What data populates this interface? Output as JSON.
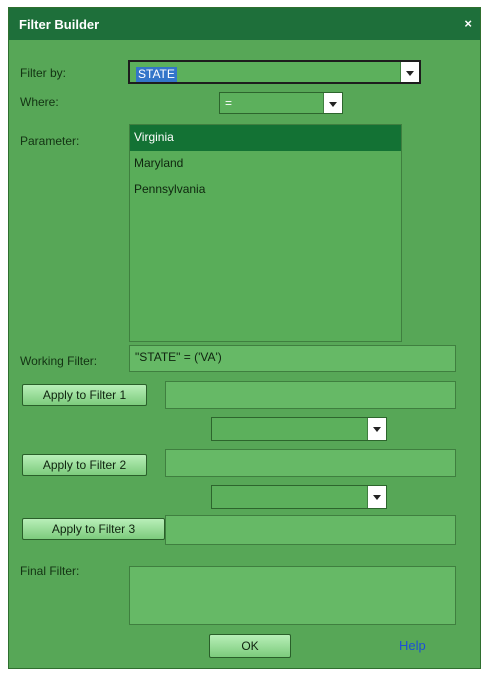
{
  "dialog": {
    "title": "Filter Builder",
    "close_label": "×"
  },
  "filter_by": {
    "label": "Filter by:",
    "value": "STATE"
  },
  "where": {
    "label": "Where:",
    "value": "="
  },
  "parameter": {
    "label": "Parameter:",
    "items": [
      {
        "label": "Virginia",
        "selected": true
      },
      {
        "label": "Maryland",
        "selected": false
      },
      {
        "label": "Pennsylvania",
        "selected": false
      }
    ]
  },
  "working_filter": {
    "label": "Working Filter:",
    "value": "\"STATE\" = ('VA')"
  },
  "apply": {
    "filter1_label": "Apply to Filter 1",
    "filter2_label": "Apply to Filter 2",
    "filter3_label": "Apply to Filter 3",
    "filter1_value": "",
    "filter2_value": "",
    "filter3_value": ""
  },
  "operators": {
    "op1_value": "",
    "op2_value": ""
  },
  "final_filter": {
    "label": "Final Filter:",
    "value": ""
  },
  "buttons": {
    "ok_label": "OK",
    "help_label": "Help"
  },
  "colors": {
    "title_bar": "#1e6f3a",
    "panel": "#57a757",
    "selected_item": "#137234",
    "help_link": "#1d4fd6"
  }
}
